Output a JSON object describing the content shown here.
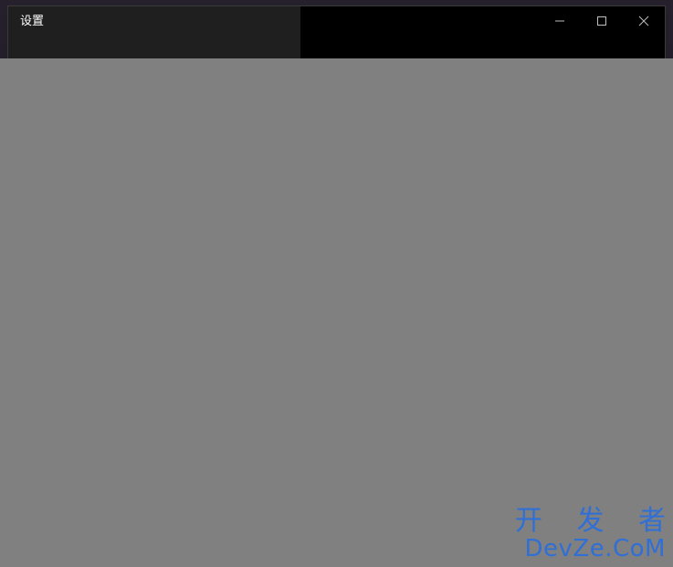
{
  "window": {
    "title": "设置"
  },
  "caption_controls": [
    {
      "name": "minimize",
      "icon": "minimize-icon"
    },
    {
      "name": "maximize",
      "icon": "maximize-icon"
    },
    {
      "name": "close",
      "icon": "close-icon"
    }
  ],
  "nav": {
    "back_icon": "back-arrow-icon"
  },
  "watermark": {
    "line1": "开 发 者",
    "line2": "DevZe.CoM"
  },
  "colors": {
    "nav_pane": "#1f1f1f",
    "content_pane": "#000000",
    "overlay": "#808080",
    "watermark": "#2f6fd6"
  }
}
